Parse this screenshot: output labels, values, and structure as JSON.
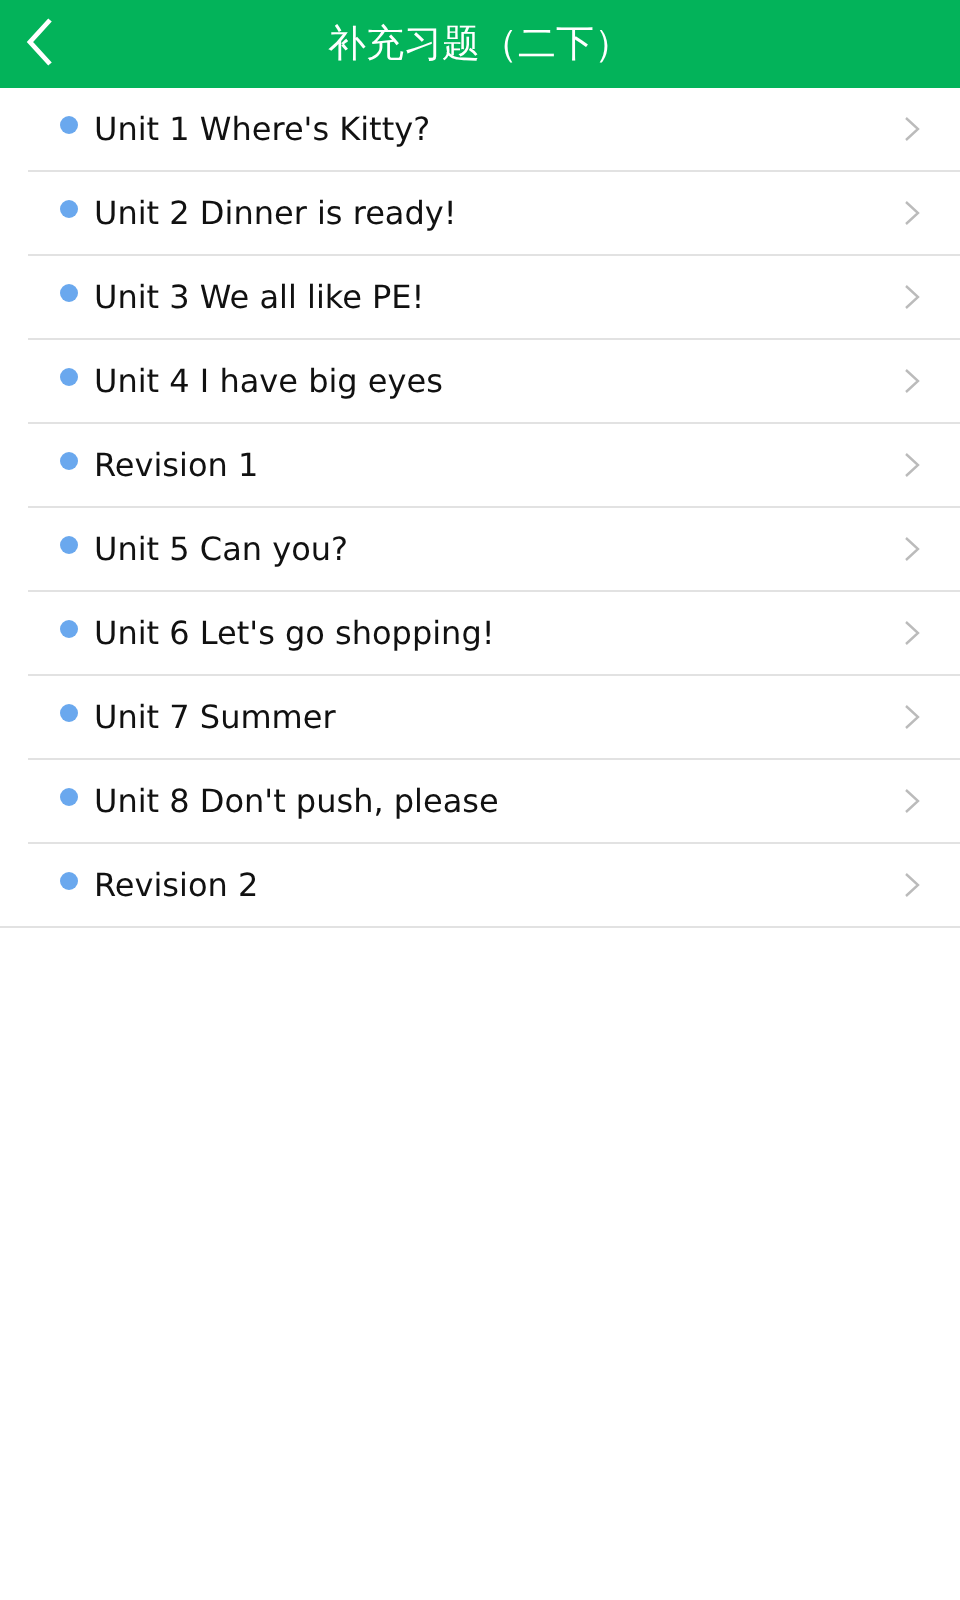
{
  "header": {
    "title": "补充习题（二下）"
  },
  "items": [
    {
      "label": "Unit 1 Where's Kitty?"
    },
    {
      "label": "Unit 2 Dinner is ready!"
    },
    {
      "label": "Unit 3 We all like PE!"
    },
    {
      "label": "Unit 4 I have big eyes"
    },
    {
      "label": "Revision 1"
    },
    {
      "label": "Unit 5 Can you?"
    },
    {
      "label": "Unit 6 Let's go shopping!"
    },
    {
      "label": "Unit 7 Summer"
    },
    {
      "label": "Unit 8 Don't push, please"
    },
    {
      "label": "Revision 2"
    }
  ]
}
